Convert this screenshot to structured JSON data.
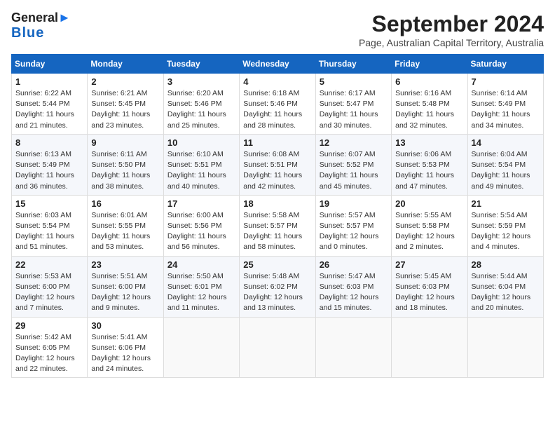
{
  "header": {
    "logo_line1": "General",
    "logo_line2": "Blue",
    "month_title": "September 2024",
    "subtitle": "Page, Australian Capital Territory, Australia"
  },
  "days_of_week": [
    "Sunday",
    "Monday",
    "Tuesday",
    "Wednesday",
    "Thursday",
    "Friday",
    "Saturday"
  ],
  "weeks": [
    [
      {
        "day": "1",
        "sunrise": "6:22 AM",
        "sunset": "5:44 PM",
        "daylight": "11 hours and 21 minutes."
      },
      {
        "day": "2",
        "sunrise": "6:21 AM",
        "sunset": "5:45 PM",
        "daylight": "11 hours and 23 minutes."
      },
      {
        "day": "3",
        "sunrise": "6:20 AM",
        "sunset": "5:46 PM",
        "daylight": "11 hours and 25 minutes."
      },
      {
        "day": "4",
        "sunrise": "6:18 AM",
        "sunset": "5:46 PM",
        "daylight": "11 hours and 28 minutes."
      },
      {
        "day": "5",
        "sunrise": "6:17 AM",
        "sunset": "5:47 PM",
        "daylight": "11 hours and 30 minutes."
      },
      {
        "day": "6",
        "sunrise": "6:16 AM",
        "sunset": "5:48 PM",
        "daylight": "11 hours and 32 minutes."
      },
      {
        "day": "7",
        "sunrise": "6:14 AM",
        "sunset": "5:49 PM",
        "daylight": "11 hours and 34 minutes."
      }
    ],
    [
      {
        "day": "8",
        "sunrise": "6:13 AM",
        "sunset": "5:49 PM",
        "daylight": "11 hours and 36 minutes."
      },
      {
        "day": "9",
        "sunrise": "6:11 AM",
        "sunset": "5:50 PM",
        "daylight": "11 hours and 38 minutes."
      },
      {
        "day": "10",
        "sunrise": "6:10 AM",
        "sunset": "5:51 PM",
        "daylight": "11 hours and 40 minutes."
      },
      {
        "day": "11",
        "sunrise": "6:08 AM",
        "sunset": "5:51 PM",
        "daylight": "11 hours and 42 minutes."
      },
      {
        "day": "12",
        "sunrise": "6:07 AM",
        "sunset": "5:52 PM",
        "daylight": "11 hours and 45 minutes."
      },
      {
        "day": "13",
        "sunrise": "6:06 AM",
        "sunset": "5:53 PM",
        "daylight": "11 hours and 47 minutes."
      },
      {
        "day": "14",
        "sunrise": "6:04 AM",
        "sunset": "5:54 PM",
        "daylight": "11 hours and 49 minutes."
      }
    ],
    [
      {
        "day": "15",
        "sunrise": "6:03 AM",
        "sunset": "5:54 PM",
        "daylight": "11 hours and 51 minutes."
      },
      {
        "day": "16",
        "sunrise": "6:01 AM",
        "sunset": "5:55 PM",
        "daylight": "11 hours and 53 minutes."
      },
      {
        "day": "17",
        "sunrise": "6:00 AM",
        "sunset": "5:56 PM",
        "daylight": "11 hours and 56 minutes."
      },
      {
        "day": "18",
        "sunrise": "5:58 AM",
        "sunset": "5:57 PM",
        "daylight": "11 hours and 58 minutes."
      },
      {
        "day": "19",
        "sunrise": "5:57 AM",
        "sunset": "5:57 PM",
        "daylight": "12 hours and 0 minutes."
      },
      {
        "day": "20",
        "sunrise": "5:55 AM",
        "sunset": "5:58 PM",
        "daylight": "12 hours and 2 minutes."
      },
      {
        "day": "21",
        "sunrise": "5:54 AM",
        "sunset": "5:59 PM",
        "daylight": "12 hours and 4 minutes."
      }
    ],
    [
      {
        "day": "22",
        "sunrise": "5:53 AM",
        "sunset": "6:00 PM",
        "daylight": "12 hours and 7 minutes."
      },
      {
        "day": "23",
        "sunrise": "5:51 AM",
        "sunset": "6:00 PM",
        "daylight": "12 hours and 9 minutes."
      },
      {
        "day": "24",
        "sunrise": "5:50 AM",
        "sunset": "6:01 PM",
        "daylight": "12 hours and 11 minutes."
      },
      {
        "day": "25",
        "sunrise": "5:48 AM",
        "sunset": "6:02 PM",
        "daylight": "12 hours and 13 minutes."
      },
      {
        "day": "26",
        "sunrise": "5:47 AM",
        "sunset": "6:03 PM",
        "daylight": "12 hours and 15 minutes."
      },
      {
        "day": "27",
        "sunrise": "5:45 AM",
        "sunset": "6:03 PM",
        "daylight": "12 hours and 18 minutes."
      },
      {
        "day": "28",
        "sunrise": "5:44 AM",
        "sunset": "6:04 PM",
        "daylight": "12 hours and 20 minutes."
      }
    ],
    [
      {
        "day": "29",
        "sunrise": "5:42 AM",
        "sunset": "6:05 PM",
        "daylight": "12 hours and 22 minutes."
      },
      {
        "day": "30",
        "sunrise": "5:41 AM",
        "sunset": "6:06 PM",
        "daylight": "12 hours and 24 minutes."
      },
      null,
      null,
      null,
      null,
      null
    ]
  ]
}
